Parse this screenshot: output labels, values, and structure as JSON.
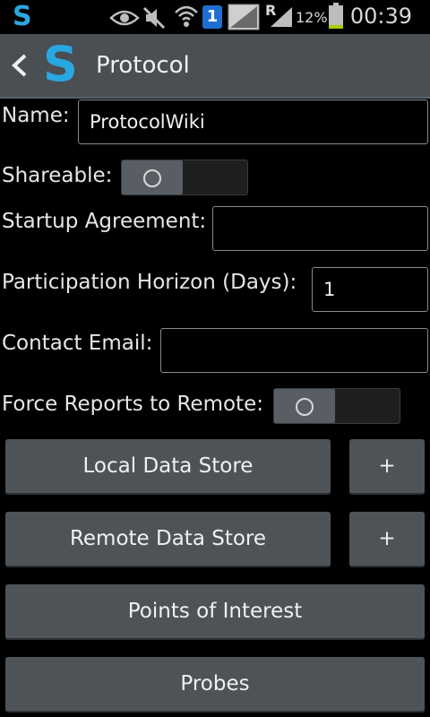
{
  "status_bar": {
    "app_icon_letter": "S",
    "battery_percent": "12%",
    "time": "00:39",
    "notification_badge": "1",
    "network_letter": "R",
    "icons": [
      "eye-icon",
      "mute-icon",
      "wifi-icon",
      "notification-icon",
      "signal-icon",
      "battery-icon"
    ]
  },
  "action_bar": {
    "logo_letter": "S",
    "title": "Protocol"
  },
  "form": {
    "name_label": "Name:",
    "name_value": "ProtocolWiki",
    "shareable_label": "Shareable:",
    "shareable_on": false,
    "startup_label": "Startup Agreement:",
    "startup_value": "",
    "horizon_label": "Participation Horizon (Days):",
    "horizon_value": "1",
    "email_label": "Contact Email:",
    "email_value": "",
    "force_reports_label": "Force Reports to Remote:",
    "force_reports_on": false
  },
  "buttons": {
    "local_data_store": "Local Data Store",
    "local_add": "+",
    "remote_data_store": "Remote Data Store",
    "remote_add": "+",
    "points_of_interest": "Points of Interest",
    "probes": "Probes"
  },
  "colors": {
    "accent": "#29a7e1",
    "action_bar": "#4a4f54",
    "button": "#4e5358",
    "background": "#000000"
  }
}
